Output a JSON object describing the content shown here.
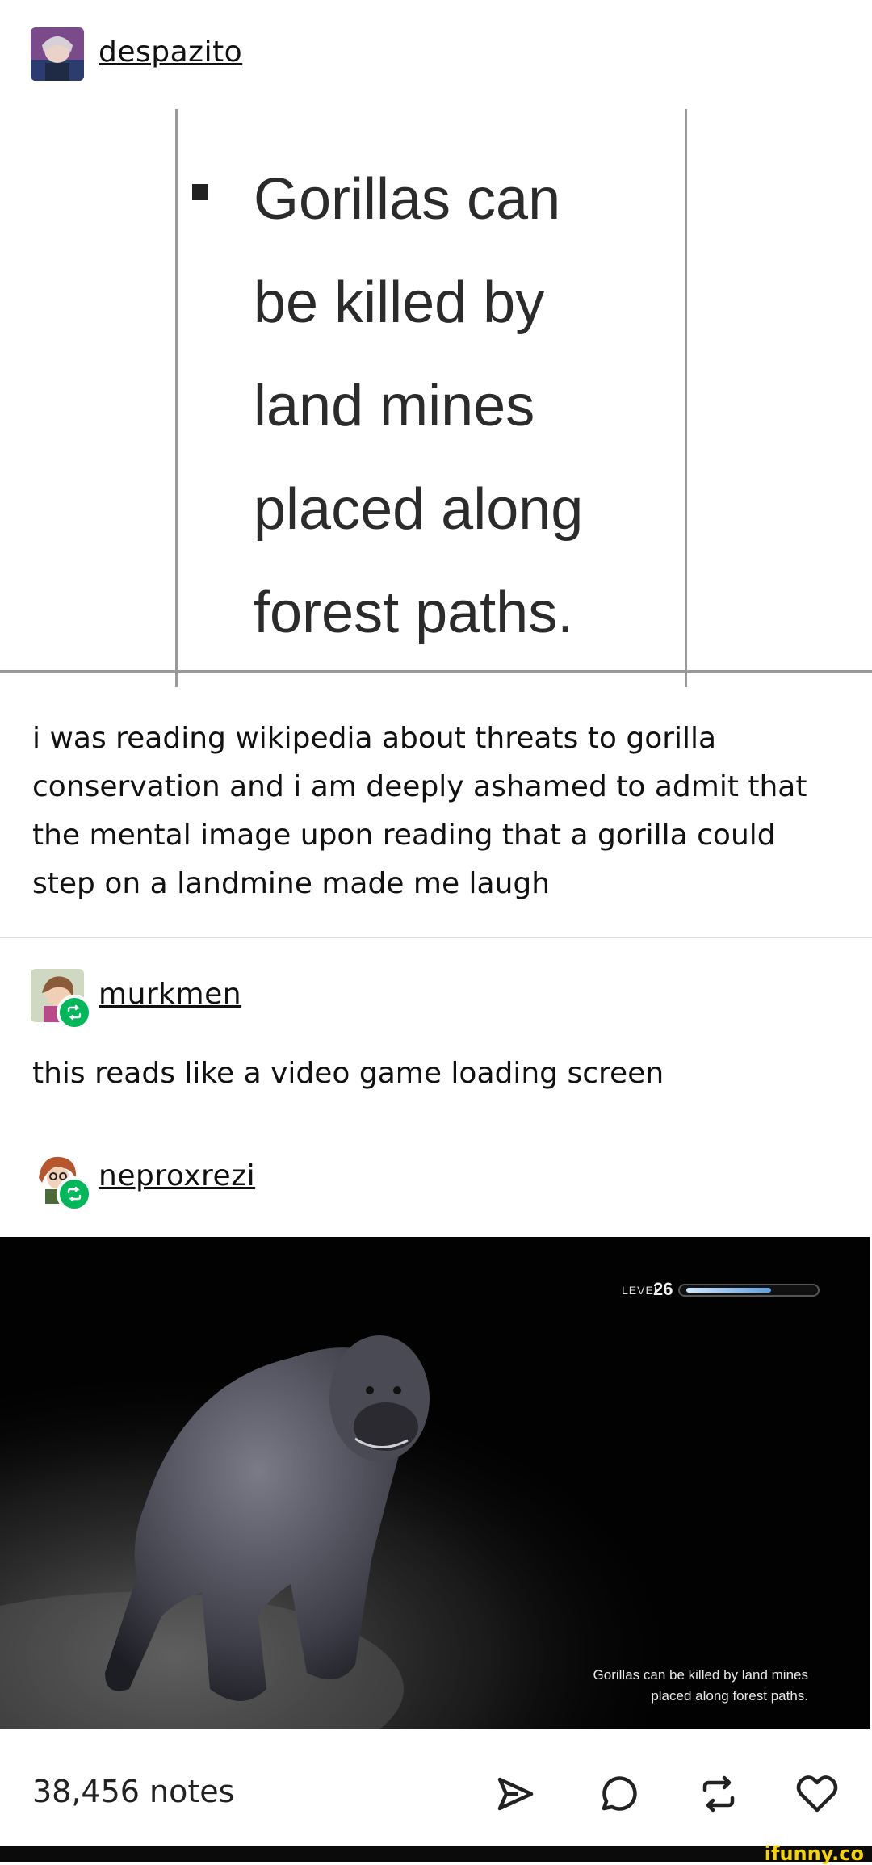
{
  "posts": [
    {
      "username": "despazito"
    },
    {
      "username": "murkmen",
      "text": "this reads like a video game loading screen"
    },
    {
      "username": "neproxrezi"
    }
  ],
  "quote": {
    "text": "Gorillas can\nbe killed by\nland mines\nplaced along\nforest paths."
  },
  "op_text": "i was reading wikipedia about threats to gorilla conservation and i am deeply ashamed to admit that the mental image upon reading that a gorilla could step on a landmine made me laugh",
  "game": {
    "level_label": "LEVEL",
    "level_value": "26",
    "level_progress": 0.68,
    "caption_line1": "Gorillas can be killed by land mines",
    "caption_line2": "placed along forest paths."
  },
  "footer": {
    "notes": "38,456 notes",
    "actions": [
      "share-icon",
      "comment-icon",
      "reblog-icon",
      "like-icon"
    ]
  },
  "brand": "ifunny.co",
  "colors": {
    "reblog_badge": "#00b85a",
    "brand": "#f5d400"
  }
}
